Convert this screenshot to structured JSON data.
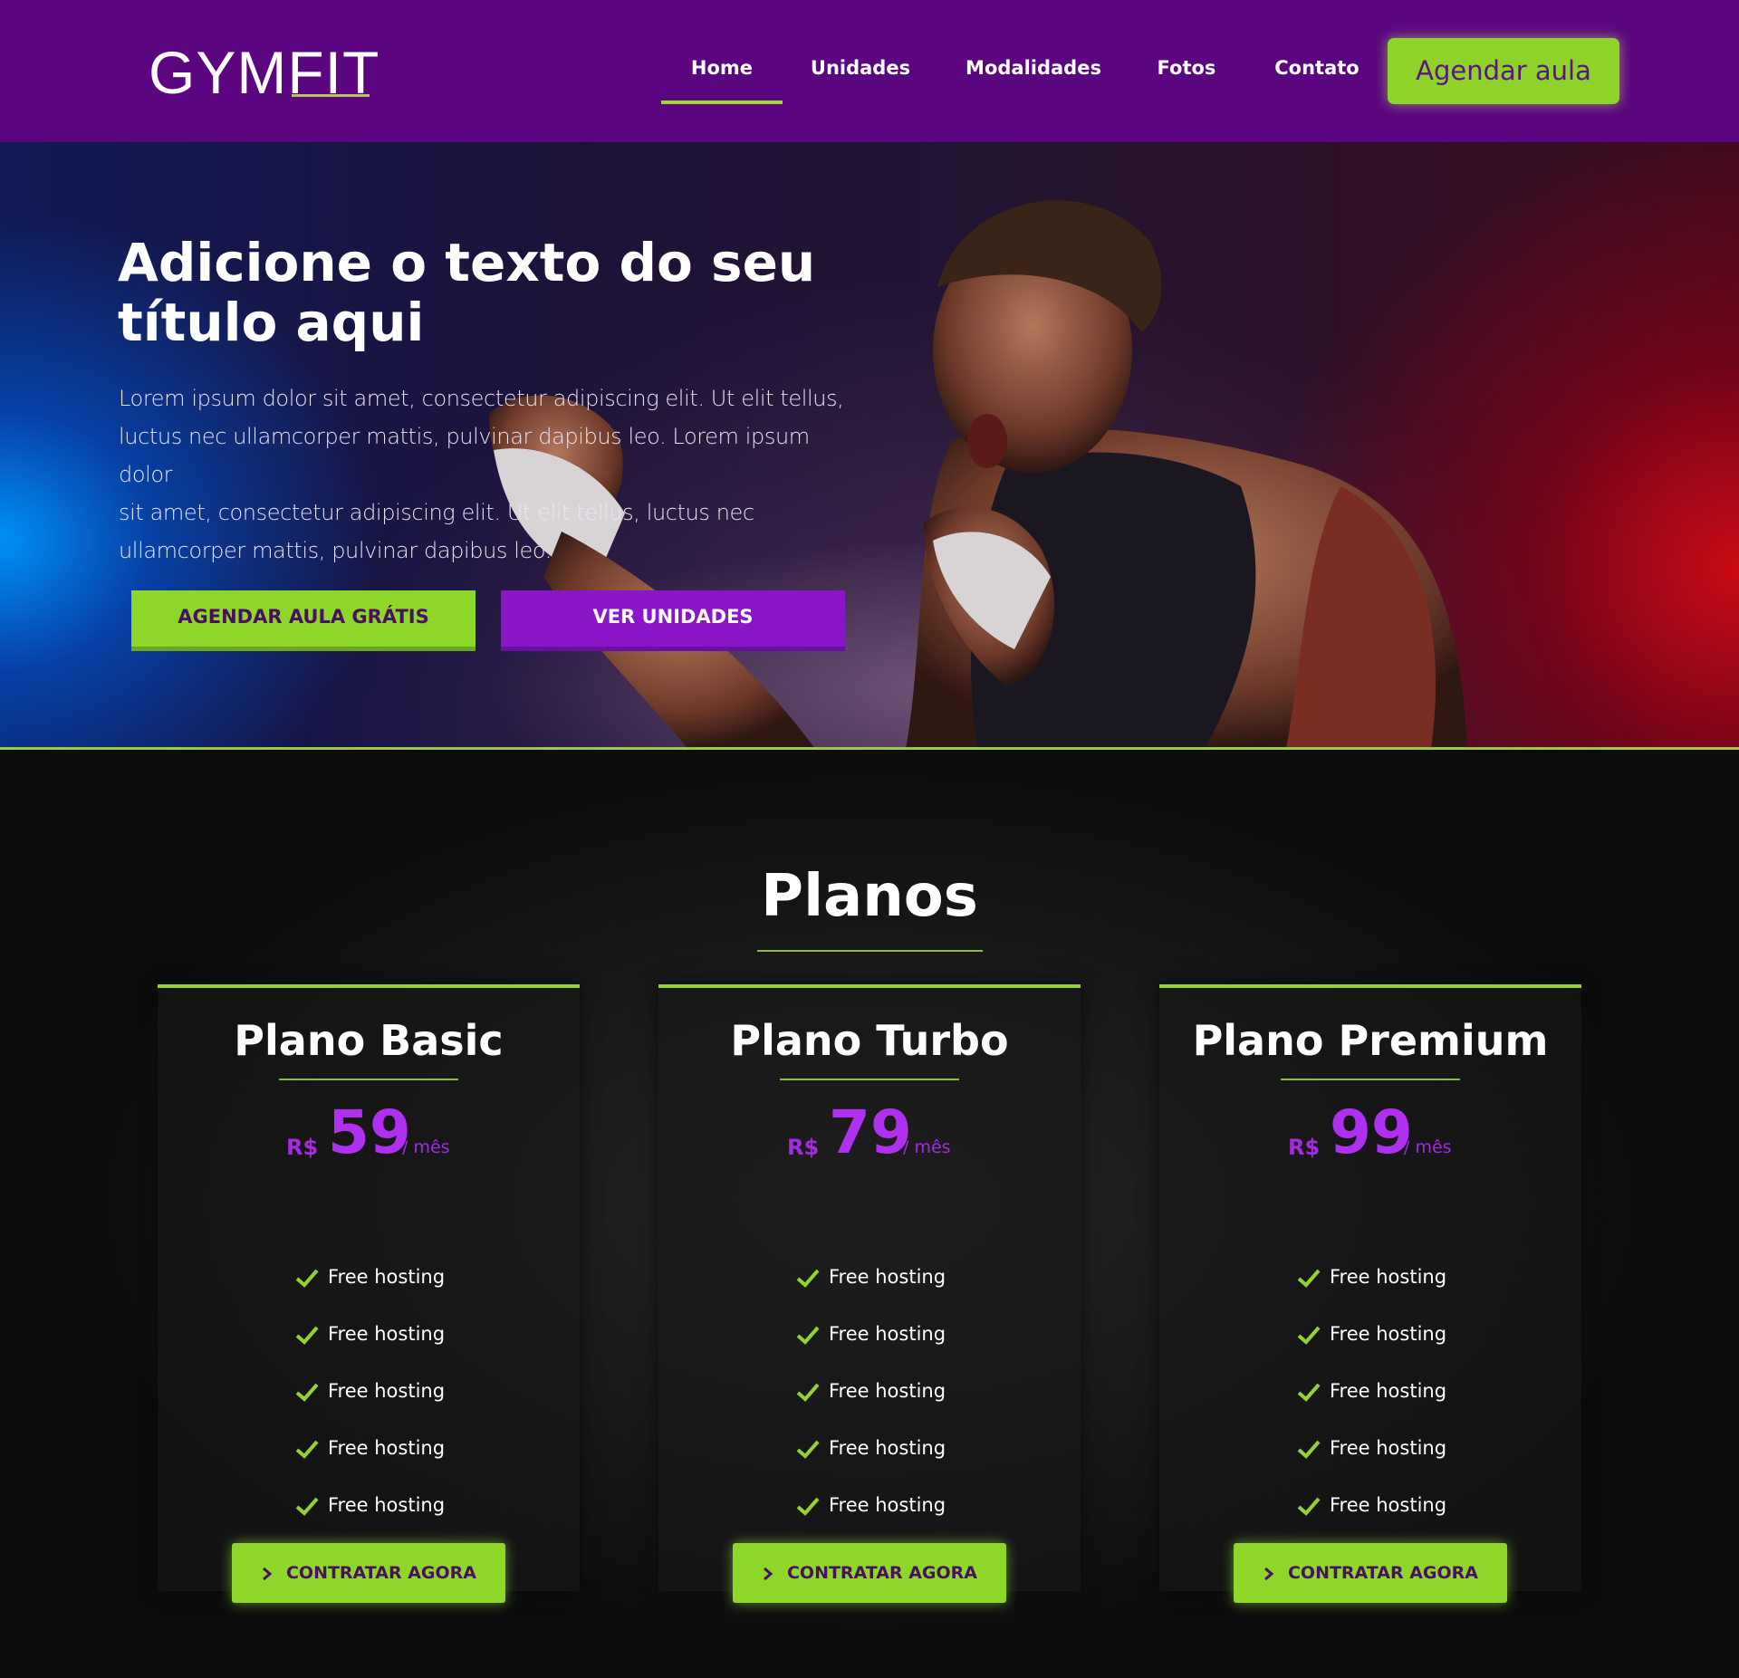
{
  "header": {
    "logo": "GYMFIT",
    "nav": [
      {
        "label": "Home",
        "active": true
      },
      {
        "label": "Unidades",
        "active": false
      },
      {
        "label": "Modalidades",
        "active": false
      },
      {
        "label": "Fotos",
        "active": false
      },
      {
        "label": "Contato",
        "active": false
      }
    ],
    "cta_label": "Agendar aula"
  },
  "hero": {
    "title_line1": "Adicione o texto do seu",
    "title_line2": "título aqui",
    "body_lines": [
      "Lorem ipsum dolor sit amet, consectetur adipiscing elit. Ut elit tellus,",
      "luctus nec ullamcorper mattis, pulvinar dapibus leo. Lorem ipsum dolor",
      "sit amet, consectetur adipiscing elit. Ut elit tellus, luctus nec",
      "ullamcorper mattis, pulvinar dapibus leo."
    ],
    "primary_button": "AGENDAR AULA GRÁTIS",
    "secondary_button": "VER UNIDADES"
  },
  "plans": {
    "title": "Planos",
    "items": [
      {
        "name": "Plano Basic",
        "currency": "R$",
        "price": "59",
        "period": "/ mês",
        "features": [
          "Free hosting",
          "Free hosting",
          "Free hosting",
          "Free hosting",
          "Free hosting"
        ],
        "button": "CONTRATAR AGORA"
      },
      {
        "name": "Plano Turbo",
        "currency": "R$",
        "price": "79",
        "period": "/ mês",
        "features": [
          "Free hosting",
          "Free hosting",
          "Free hosting",
          "Free hosting",
          "Free hosting"
        ],
        "button": "CONTRATAR AGORA"
      },
      {
        "name": "Plano Premium",
        "currency": "R$",
        "price": "99",
        "period": "/ mês",
        "features": [
          "Free hosting",
          "Free hosting",
          "Free hosting",
          "Free hosting",
          "Free hosting"
        ],
        "button": "CONTRATAR AGORA"
      }
    ]
  },
  "colors": {
    "header_bg": "#5b0680",
    "accent_green": "#8fd62a",
    "accent_purple": "#8a16c8",
    "price_purple": "#b030f0",
    "page_bg": "#0d0d0d"
  }
}
